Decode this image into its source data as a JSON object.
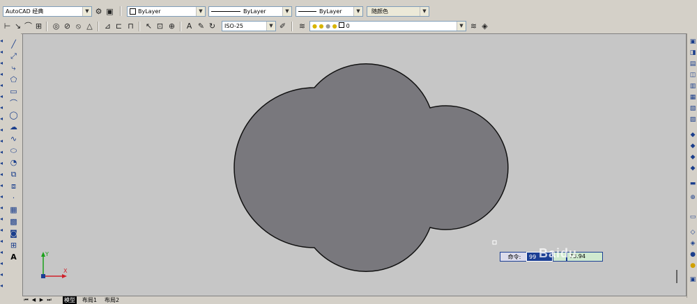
{
  "workspace": {
    "label": "AutoCAD 经典"
  },
  "properties": {
    "color": "ByLayer",
    "linetype": "ByLayer",
    "lineweight": "ByLayer",
    "plotstyle": "随颜色"
  },
  "dimstyle": {
    "value": "ISO-25"
  },
  "layer": {
    "value": "0"
  },
  "tabs": [
    {
      "label": "模型"
    },
    {
      "label": "布局1"
    },
    {
      "label": "布局2"
    }
  ],
  "ucs": {
    "x_label": "X",
    "y_label": "Y"
  },
  "command": {
    "prompt": "命令:",
    "value_1": "99",
    "value_2": "73.94"
  },
  "watermark": {
    "text": "Baidu"
  },
  "colors": {
    "canvas_bg": "#c6c6c6",
    "shape_fill": "#79787d",
    "shape_stroke": "#111111",
    "ucs_x": "#d0202a",
    "ucs_y": "#1aa11a",
    "input_highlight": "#1c3f94"
  }
}
